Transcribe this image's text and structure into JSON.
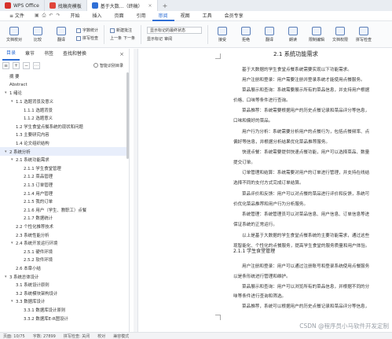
{
  "titlebar": {
    "tabs": [
      {
        "label": "WPS Office",
        "color": "#d6312b"
      },
      {
        "label": "找稿壳模板",
        "color": "#e0453a"
      },
      {
        "label": "基于大数...（终稿）",
        "color": "#2f6fd6"
      }
    ]
  },
  "menubar": {
    "file": "≡ 文件",
    "items": [
      "开始",
      "插入",
      "页面",
      "引用",
      "审阅",
      "视图",
      "工具",
      "会员专享"
    ],
    "active": "审阅"
  },
  "toolbar": {
    "buttons": [
      "文档校对",
      "比较",
      "翻译",
      "字数统计",
      "拼写检查"
    ],
    "stack1": [
      "字数统计",
      "拼写检查"
    ],
    "stack2": [
      "新建批注",
      "上一条",
      "下一条"
    ],
    "select_value": "显示标记的最终状态",
    "stack3": [
      "显示标记",
      "审阅"
    ],
    "right_buttons": [
      "接受",
      "拒绝",
      "限制编辑",
      "文档权限",
      "拼写检查"
    ],
    "misc": [
      "翻译",
      "朗读"
    ]
  },
  "sidebar": {
    "tabs": [
      "目录",
      "章节",
      "书签",
      "查找和替换"
    ],
    "active_tab": "目录",
    "smart_label": "智能识别目录",
    "toc": [
      {
        "text": "摘 要",
        "level": 1,
        "arrow": ""
      },
      {
        "text": "Abstract",
        "level": 1,
        "arrow": ""
      },
      {
        "text": "1 绪论",
        "level": 1,
        "arrow": "▾"
      },
      {
        "text": "1.1 选题背景及意义",
        "level": 2,
        "arrow": "▾"
      },
      {
        "text": "1.1.1 选题背景",
        "level": 3,
        "arrow": ""
      },
      {
        "text": "1.1.2 选题意义",
        "level": 3,
        "arrow": ""
      },
      {
        "text": "1.2 学生食堂点餐系统的现状和问题",
        "level": 2,
        "arrow": ""
      },
      {
        "text": "1.3 主要研究内容",
        "level": 2,
        "arrow": ""
      },
      {
        "text": "1.4 论文组织结构",
        "level": 2,
        "arrow": ""
      },
      {
        "text": "2 系统分析",
        "level": 1,
        "arrow": "▾",
        "sel": true
      },
      {
        "text": "2.1 系统功能需求",
        "level": 2,
        "arrow": "▾"
      },
      {
        "text": "2.1.1 学生食堂管理",
        "level": 3,
        "arrow": ""
      },
      {
        "text": "2.1.2 菜品管理",
        "level": 3,
        "arrow": ""
      },
      {
        "text": "2.1.3 订单管理",
        "level": 3,
        "arrow": ""
      },
      {
        "text": "2.1.4 用户管理",
        "level": 3,
        "arrow": ""
      },
      {
        "text": "2.1.5 我的订单",
        "level": 3,
        "arrow": ""
      },
      {
        "text": "2.1.6 用户（学生、教职工）点餐",
        "level": 3,
        "arrow": ""
      },
      {
        "text": "2.1.7 数据统计",
        "level": 3,
        "arrow": ""
      },
      {
        "text": "2.2 个性化推荐技术",
        "level": 2,
        "arrow": ""
      },
      {
        "text": "2.3 系统性能分析",
        "level": 2,
        "arrow": ""
      },
      {
        "text": "2.4 系统开发运行环境",
        "level": 2,
        "arrow": "▾"
      },
      {
        "text": "2.5.1 硬件环境",
        "level": 3,
        "arrow": ""
      },
      {
        "text": "2.5.2 软件环境",
        "level": 3,
        "arrow": ""
      },
      {
        "text": "2.6 本章小结",
        "level": 2,
        "arrow": ""
      },
      {
        "text": "3 系统总体设计",
        "level": 1,
        "arrow": "▾"
      },
      {
        "text": "3.1 系统设计原则",
        "level": 2,
        "arrow": ""
      },
      {
        "text": "3.2 系统模块架构设计",
        "level": 2,
        "arrow": ""
      },
      {
        "text": "3.3 数据库设计",
        "level": 2,
        "arrow": "▾"
      },
      {
        "text": "3.3.1 数据库设计原则",
        "level": 3,
        "arrow": ""
      },
      {
        "text": "3.3.2 数据库E-R图设计",
        "level": 3,
        "arrow": ""
      }
    ]
  },
  "document": {
    "heading": "2.1  系统功能需求",
    "paragraphs": [
      "  基于大数据的学生食堂点餐系统需要实现以下功能需求。",
      "用户注册和登录：用户需要注册并登录系统才能使用点餐服务。",
      "菜品展示和查询：系统需要展示所有的菜品信息，并支持用户根据",
      "价格、口味等条件进行查询。",
      "菜品推荐：系统需要根据用户的历史点餐记录和菜品评分等信息，",
      "口味和偏好的菜品。",
      "用户行为分析：系统需要分析用户的点餐行为，包括点餐频率、点",
      "偏好等信息，并根据分析结果优化菜品推荐服务。",
      "快速点餐：系统需要提供快速点餐功能，用户可以选择菜品、数量",
      "提交订单。",
      "订单管理和结算：系统需要对用户的订单进行管理，并支持在线结",
      "选择不同的支付方式完成订单结算。",
      "菜品评价和反馈：用户可以对点餐的菜品进行评价和反馈，系统可",
      "价优化菜品推荐和用户行为分析服务。",
      "系统管理：系统管理员可以对菜品信息、用户信息、订单信息等进",
      "保证系统的正常运行。",
      "以上是基于大数据的学生食堂点餐系统的主要功能需求，通过这些",
      "现智能化、个性化的点餐服务，提高学生食堂的服务质量和用户体验。"
    ],
    "subheading": "2.1.1  学生食堂管理",
    "paragraphs2": [
      "用户注册和登录：用户可以通过注册账号和登录系统使用点餐服务",
      "以是条形统进行管理和维护。",
      "菜品展示和查询：用户可以浏览所有的菜品信息，并根据不同的分",
      "味等条件进行查询和筛选。",
      "菜品推荐，系统可以根据用户的历史点餐记录和菜品评分等信息，"
    ]
  },
  "statusbar": {
    "page": "页面: 10/75",
    "words": "字数: 27899",
    "spell": "拼写检查: 关闭",
    "proof": "校对",
    "mode": "兼容模式"
  },
  "watermark": "CSDN @程序员小马软件开发定制"
}
